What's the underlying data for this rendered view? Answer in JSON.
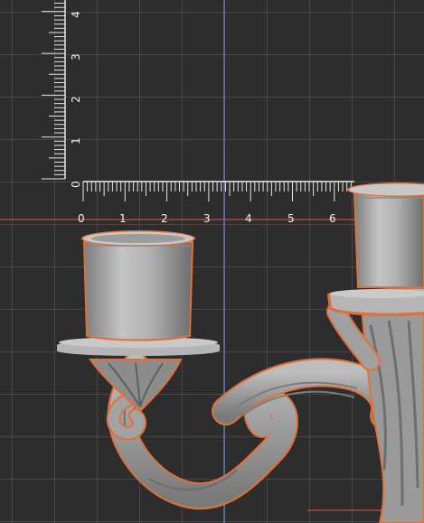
{
  "viewport": {
    "background": "#2d2d2d",
    "grid_color": "#5a5a5a",
    "axis_blue": "#5a8fd0",
    "axis_red": "#d04a4a",
    "selection_outline": "#e0703a",
    "model_color": "#a9a9a9"
  },
  "ruler_horizontal": {
    "labels": [
      "0",
      "1",
      "2",
      "3",
      "4",
      "5",
      "6"
    ]
  },
  "ruler_vertical": {
    "labels": [
      "0",
      "1",
      "2",
      "3",
      "4"
    ]
  },
  "model": {
    "name": "candelabra"
  }
}
